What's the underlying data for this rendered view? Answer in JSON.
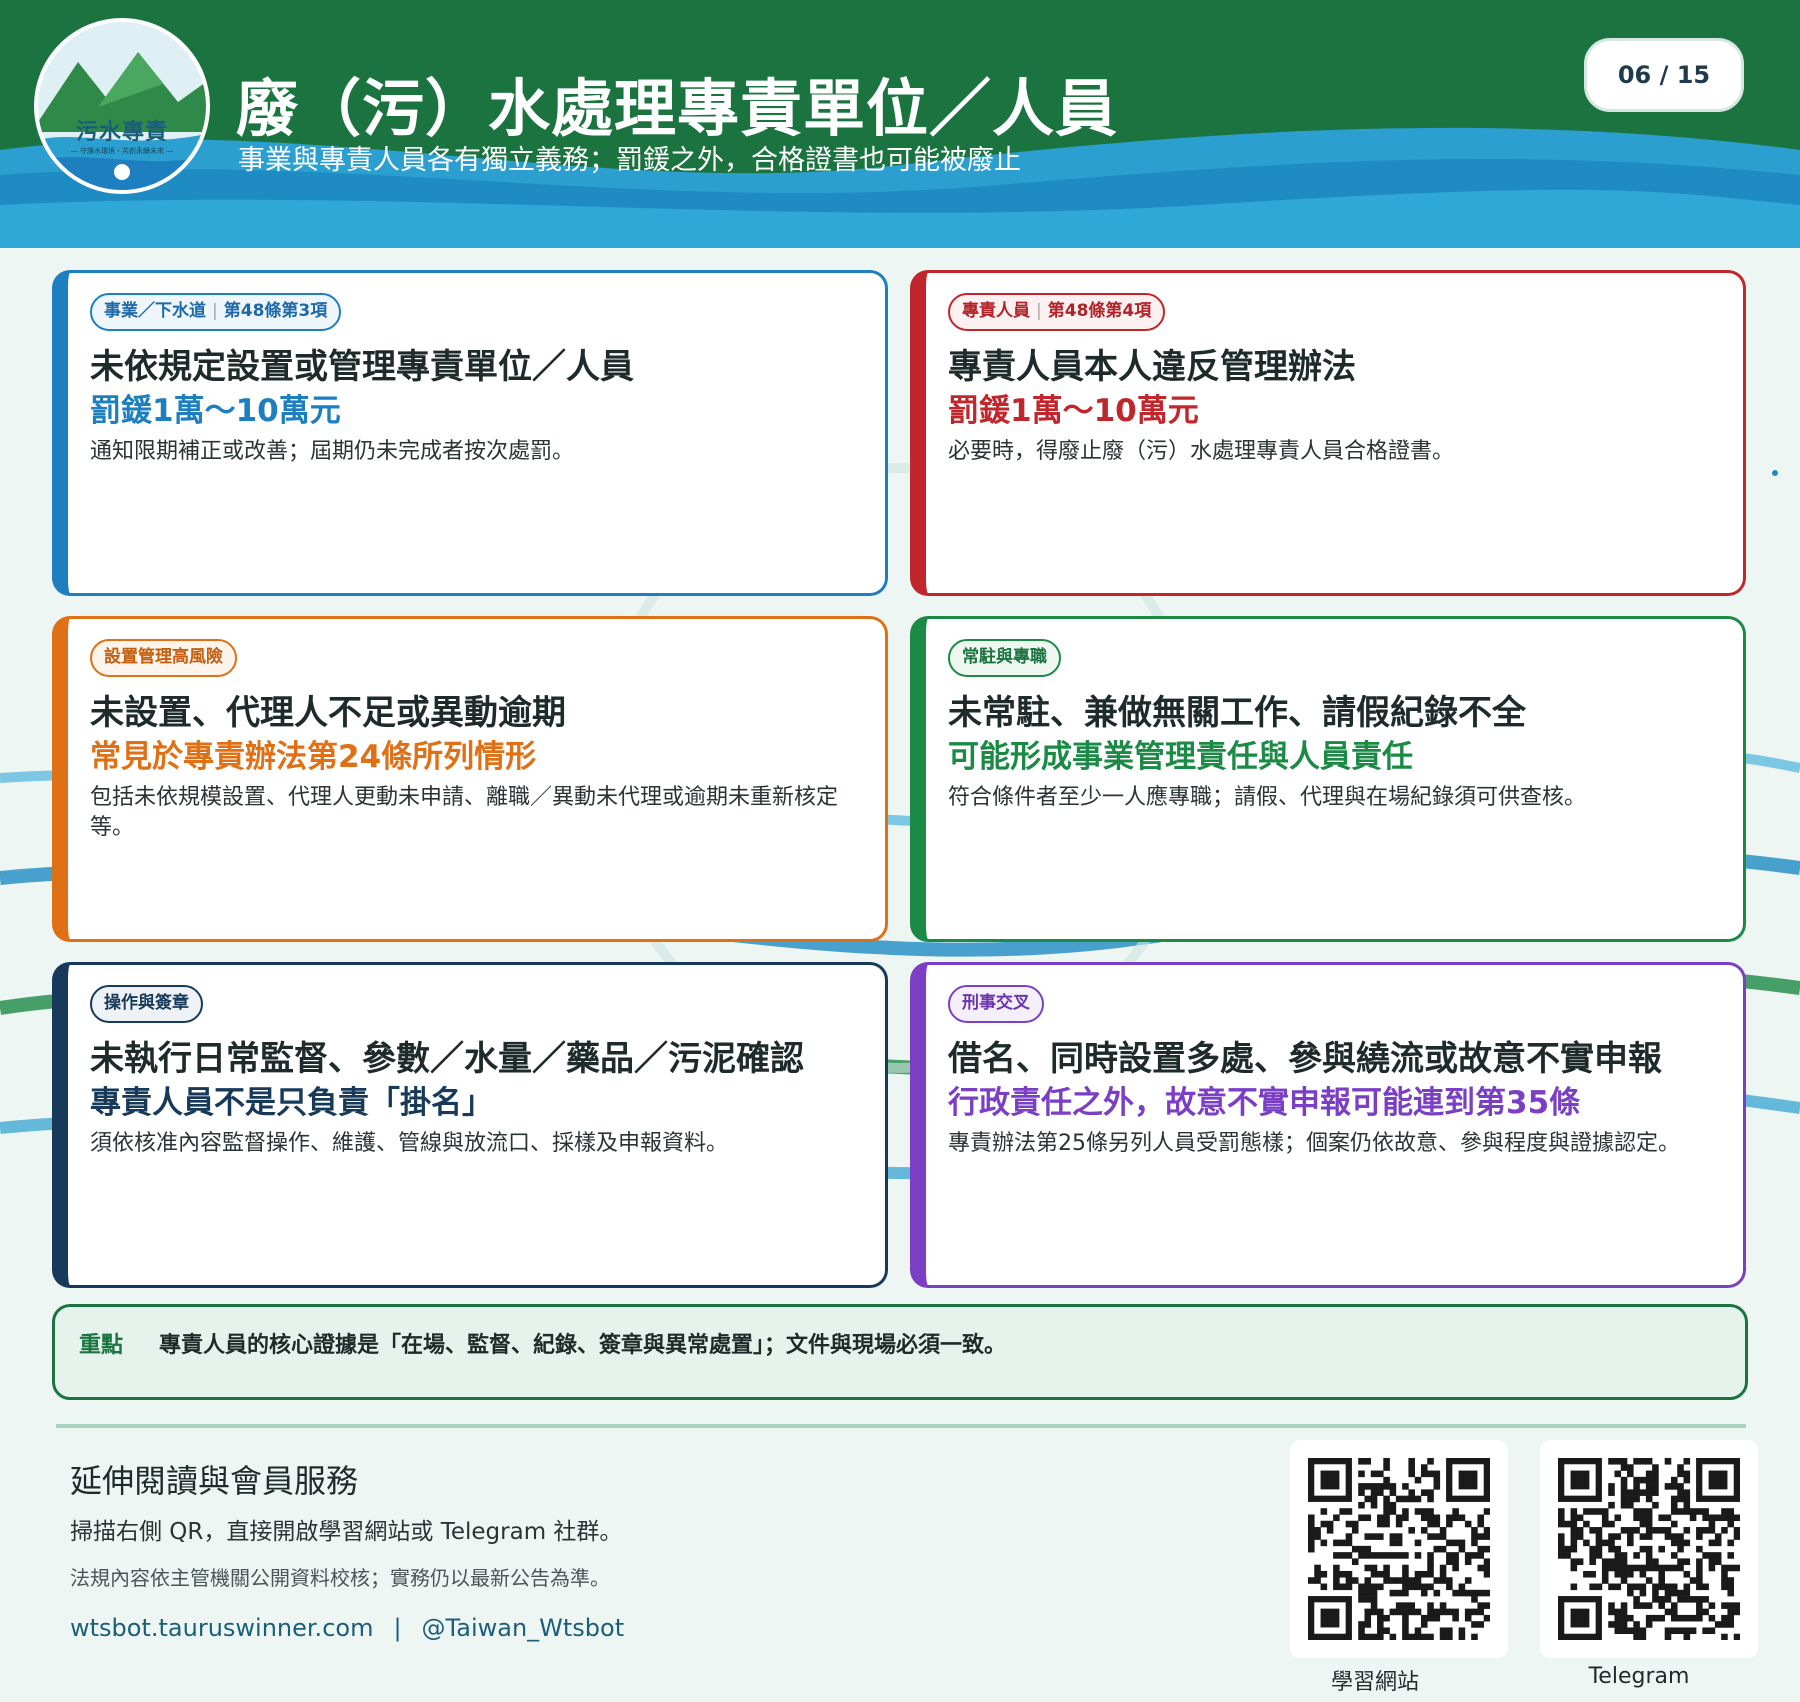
{
  "header": {
    "logo_text": "污水專責",
    "logo_subtext": "— 守護水環境・共創永續未來 —",
    "title": "廢（污）水處理專責單位／人員",
    "subtitle": "事業與專責人員各有獨立義務；罰鍰之外，合格證書也可能被廢止",
    "page_counter": "06 / 15"
  },
  "cards": [
    {
      "badge_left": "事業／下水道",
      "badge_right": "第48條第3項",
      "title": "未依規定設置或管理專責單位／人員",
      "highlight": "罰鍰1萬～10萬元",
      "description": "通知限期補正或改善；屆期仍未完成者按次處罰。",
      "color": "#1e7fc0"
    },
    {
      "badge_left": "專責人員",
      "badge_right": "第48條第4項",
      "title": "專責人員本人違反管理辦法",
      "highlight": "罰鍰1萬～10萬元",
      "description": "必要時，得廢止廢（污）水處理專責人員合格證書。",
      "color": "#c0262b"
    },
    {
      "badge_left": "設置管理高風險",
      "badge_right": "",
      "title": "未設置、代理人不足或異動逾期",
      "highlight": "常見於專責辦法第24條所列情形",
      "description": "包括未依規模設置、代理人更動未申請、離職／異動未代理或逾期未重新核定等。",
      "color": "#e07016"
    },
    {
      "badge_left": "常駐與專職",
      "badge_right": "",
      "title": "未常駐、兼做無關工作、請假紀錄不全",
      "highlight": "可能形成事業管理責任與人員責任",
      "description": "符合條件者至少一人應專職；請假、代理與在場紀錄須可供查核。",
      "color": "#1b8a45"
    },
    {
      "badge_left": "操作與簽章",
      "badge_right": "",
      "title": "未執行日常監督、參數／水量／藥品／污泥確認",
      "highlight": "專責人員不是只負責「掛名」",
      "description": "須依核准內容監督操作、維護、管線與放流口、採樣及申報資料。",
      "color": "#173a5a"
    },
    {
      "badge_left": "刑事交叉",
      "badge_right": "",
      "title": "借名、同時設置多處、參與繞流或故意不實申報",
      "highlight": "行政責任之外，故意不實申報可能連到第35條",
      "description": "專責辦法第25條另列人員受罰態樣；個案仍依故意、參與程度與證據認定。",
      "color": "#7a3fc4"
    }
  ],
  "keypoint": {
    "label": "重點",
    "text": "專責人員的核心證據是「在場、監督、紀錄、簽章與異常處置」；文件與現場必須一致。"
  },
  "footer": {
    "heading": "延伸閱讀與會員服務",
    "line1": "掃描右側 QR，直接開啟學習網站或 Telegram 社群。",
    "line2": "法規內容依主管機關公開資料校核；實務仍以最新公告為準。",
    "website": "wtsbot.tauruswinner.com",
    "divider": "|",
    "telegram_handle": "@Taiwan_Wtsbot",
    "qr_codes": [
      {
        "caption": "學習網站"
      },
      {
        "caption": "Telegram"
      }
    ]
  },
  "colors": {
    "header_green": "#1b7440",
    "header_blue": "#1e8bc3",
    "card_blue": "#1e7fc0",
    "card_red": "#c0262b",
    "card_orange": "#e07016",
    "card_green": "#1b8a45",
    "card_navy": "#173a5a",
    "card_purple": "#7a3fc4"
  }
}
